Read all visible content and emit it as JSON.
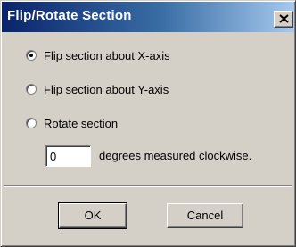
{
  "window": {
    "title": "Flip/Rotate Section",
    "close_icon": "close-icon"
  },
  "options": [
    {
      "label": "Flip section about X-axis",
      "checked": true
    },
    {
      "label": "Flip section about Y-axis",
      "checked": false
    },
    {
      "label": "Rotate section",
      "checked": false
    }
  ],
  "rotation": {
    "value": "0",
    "unit_label": "degrees measured clockwise."
  },
  "buttons": {
    "ok_label": "OK",
    "cancel_label": "Cancel"
  },
  "colors": {
    "title_gradient_start": "#0a246a",
    "title_gradient_end": "#a6caf0",
    "dialog_face": "#d4d0c8"
  }
}
